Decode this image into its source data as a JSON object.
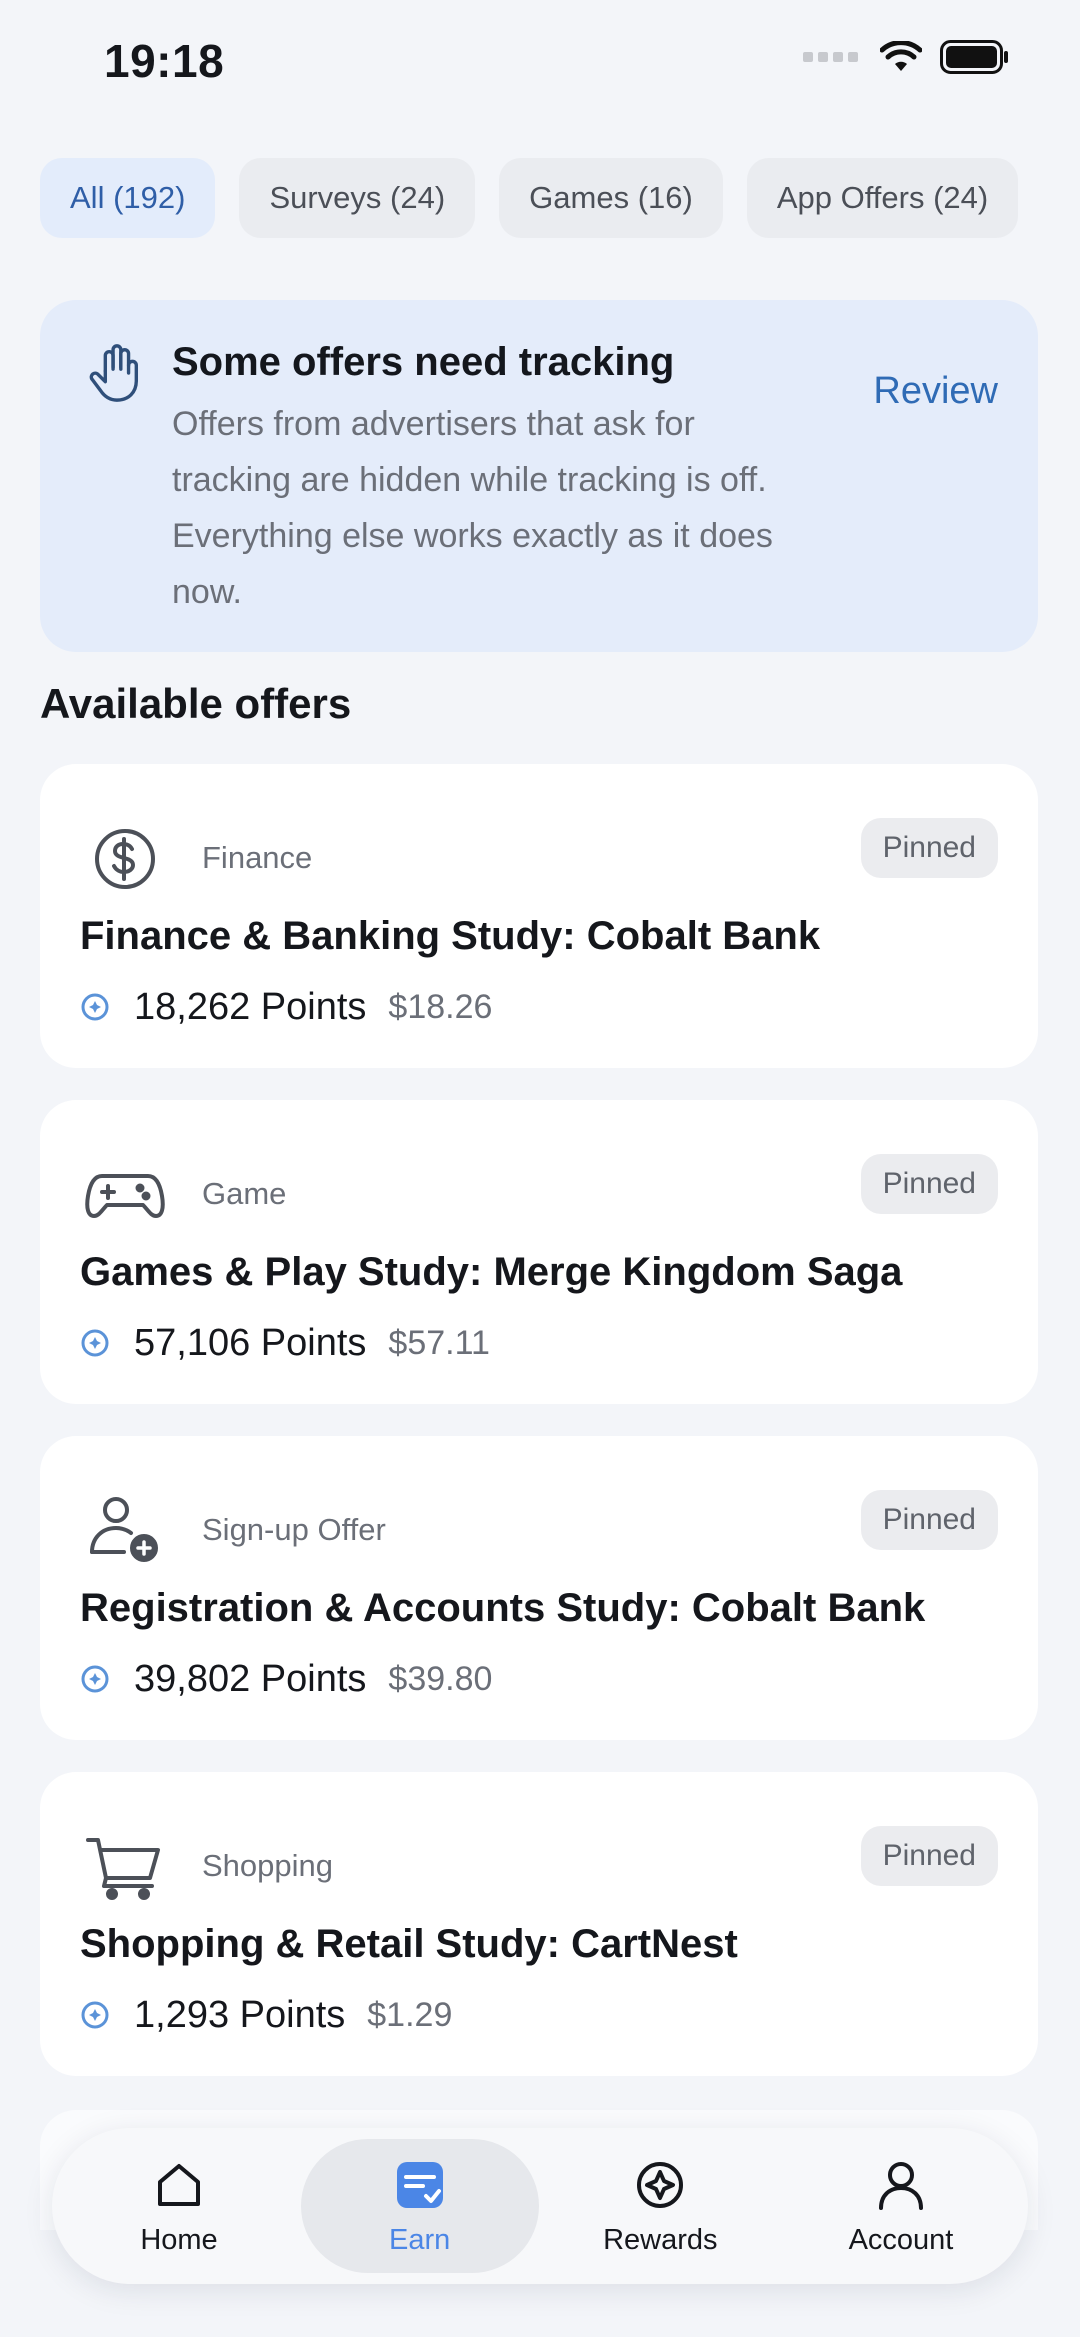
{
  "status_bar": {
    "time": "19:18"
  },
  "filters": [
    {
      "label": "All (192)",
      "active": true
    },
    {
      "label": "Surveys (24)",
      "active": false
    },
    {
      "label": "Games (16)",
      "active": false
    },
    {
      "label": "App Offers (24)",
      "active": false
    }
  ],
  "banner": {
    "icon": "hand-icon",
    "title": "Some offers need tracking",
    "text": "Offers from advertisers that ask for tracking are hidden while tracking is off. Everything else works exactly as it does now.",
    "action": "Review"
  },
  "section_title": "Available offers",
  "offers": [
    {
      "icon": "dollar-icon",
      "category": "Finance",
      "badge": "Pinned",
      "title": "Finance & Banking Study: Cobalt Bank",
      "points": "18,262 Points",
      "dollars": "$18.26"
    },
    {
      "icon": "gamepad-icon",
      "category": "Game",
      "badge": "Pinned",
      "title": "Games & Play Study: Merge Kingdom Saga",
      "points": "57,106 Points",
      "dollars": "$57.11"
    },
    {
      "icon": "user-plus-icon",
      "category": "Sign-up Offer",
      "badge": "Pinned",
      "title": "Registration & Accounts Study: Cobalt Bank",
      "points": "39,802 Points",
      "dollars": "$39.80"
    },
    {
      "icon": "cart-icon",
      "category": "Shopping",
      "badge": "Pinned",
      "title": "Shopping & Retail Study: CartNest",
      "points": "1,293 Points",
      "dollars": "$1.29"
    }
  ],
  "nav": [
    {
      "label": "Home",
      "icon": "home-icon",
      "active": false
    },
    {
      "label": "Earn",
      "icon": "earn-icon",
      "active": true
    },
    {
      "label": "Rewards",
      "icon": "rewards-icon",
      "active": false
    },
    {
      "label": "Account",
      "icon": "account-icon",
      "active": false
    }
  ],
  "colors": {
    "accent": "#2f6bb5",
    "active_nav": "#4b86e6",
    "banner_bg": "#e4ecfa"
  }
}
